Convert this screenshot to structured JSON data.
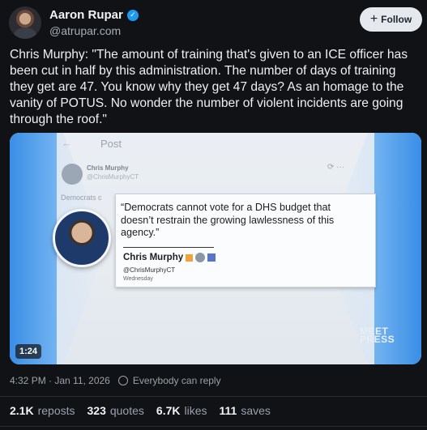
{
  "author": {
    "display_name": "Aaron Rupar",
    "handle": "@atrupar.com",
    "follow_label": "Follow"
  },
  "post": {
    "text": "Chris Murphy: \"The amount of training that's given to an ICE officer has been cut in half by this administration. The number of days of training they get are 47. You know why they get 47 days? As an homage to the vanity of POTUS. No wonder the number of violent incidents are going through the roof.\""
  },
  "media": {
    "duration": "1:24",
    "background_post": {
      "title": "Post",
      "name": "Chris Murphy",
      "handle": "@ChrisMurphyCT",
      "text": "Democrats c"
    },
    "quote": {
      "text": "“Democrats cannot vote for a DHS budget that doesn’t restrain the growing lawlessness of this agency.”",
      "name": "Chris Murphy",
      "handle": "@ChrisMurphyCT",
      "day": "Wednesday"
    },
    "logo_line1": "MEET",
    "logo_line2": "PRESS"
  },
  "meta": {
    "timestamp": "4:32 PM · Jan 11, 2026",
    "reply_setting": "Everybody can reply"
  },
  "stats": [
    {
      "value": "2.1K",
      "label": "reposts"
    },
    {
      "value": "323",
      "label": "quotes"
    },
    {
      "value": "6.7K",
      "label": "likes"
    },
    {
      "value": "111",
      "label": "saves"
    }
  ],
  "colors": {
    "background": "#101216",
    "verified": "#1d9bf0",
    "follow_button": "#e5e9ee"
  }
}
